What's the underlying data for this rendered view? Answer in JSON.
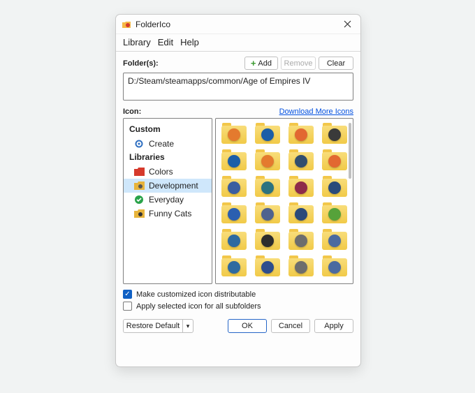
{
  "titlebar": {
    "title": "FolderIco"
  },
  "menubar": {
    "items": [
      "Library",
      "Edit",
      "Help"
    ]
  },
  "folders": {
    "label": "Folder(s):",
    "buttons": {
      "add": "Add",
      "remove": "Remove",
      "clear": "Clear"
    },
    "path": "D:/Steam/steamapps/common/Age of Empires IV"
  },
  "icon_section": {
    "label": "Icon:",
    "download_link": "Download More Icons"
  },
  "tree": {
    "custom_header": "Custom",
    "custom_items": [
      {
        "label": "Create",
        "icon": "gear-icon"
      }
    ],
    "libraries_header": "Libraries",
    "libraries_items": [
      {
        "label": "Colors",
        "icon": "folder-red-icon",
        "selected": false
      },
      {
        "label": "Development",
        "icon": "folder-yellow-icon",
        "selected": true
      },
      {
        "label": "Everyday",
        "icon": "check-circle-icon",
        "selected": false
      },
      {
        "label": "Funny Cats",
        "icon": "folder-yellow-icon",
        "selected": false
      }
    ]
  },
  "grid": {
    "badge_colors": [
      "#e47a2e",
      "#1b5ea8",
      "#e26831",
      "#3a3a3a",
      "#1b5ea8",
      "#e47a2e",
      "#314e6e",
      "#e26831",
      "#3a5ea0",
      "#2b7280",
      "#8e2b4a",
      "#2a4a7a",
      "#2b5fb0",
      "#4f638f",
      "#2a4a7a",
      "#56a23a",
      "#2e6aa0",
      "#2d2d2d",
      "#6d6d6d",
      "#4b6aa0",
      "#2e6aa0",
      "#2d4d8d",
      "#6d6d6d",
      "#4b6aa0"
    ]
  },
  "checks": {
    "distributable": {
      "checked": true,
      "label": "Make customized icon distributable"
    },
    "subfolders": {
      "checked": false,
      "label": "Apply selected icon for all subfolders"
    }
  },
  "footer": {
    "restore": "Restore Default",
    "ok": "OK",
    "cancel": "Cancel",
    "apply": "Apply"
  }
}
